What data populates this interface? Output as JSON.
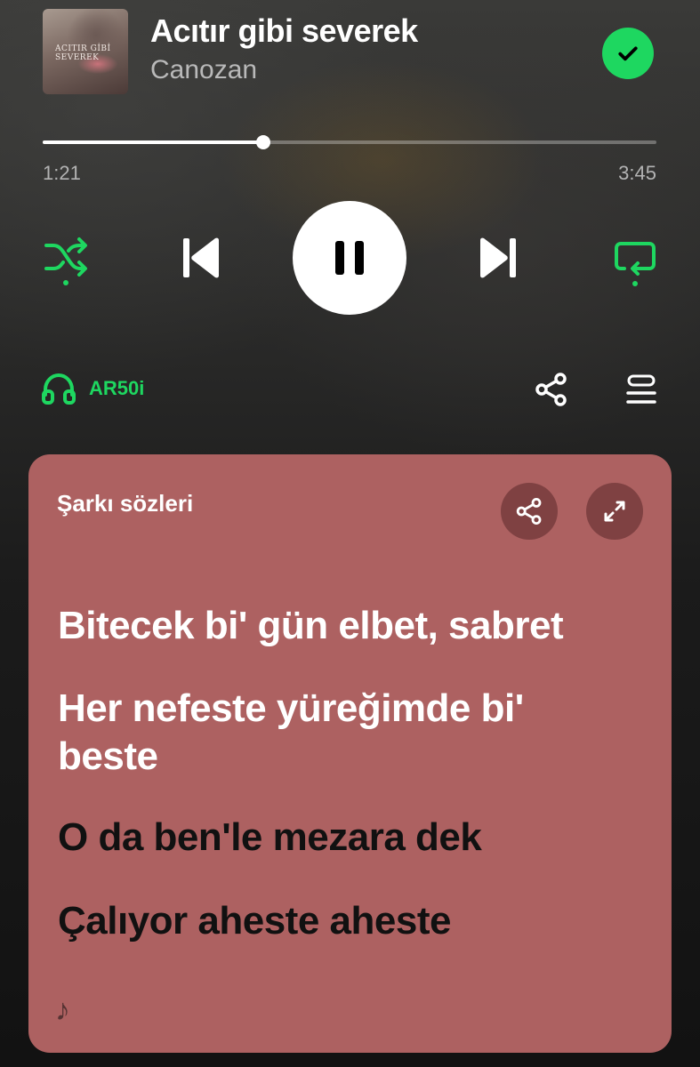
{
  "now_playing": {
    "album_art_text": "ACITIR GİBİ SEVEREK",
    "title": "Acıtır gibi severek",
    "artist": "Canozan",
    "liked": true
  },
  "playback": {
    "elapsed": "1:21",
    "duration": "3:45",
    "progress_fraction": 0.36,
    "is_playing": true,
    "shuffle_on": true,
    "repeat_on": true
  },
  "device": {
    "icon": "headphones-icon",
    "name": "AR50i"
  },
  "lyrics": {
    "title": "Şarkı sözleri",
    "lines": [
      {
        "text": "Bitecek bi' gün elbet, sabret",
        "state": "past"
      },
      {
        "text": "Her nefeste yüreğimde bi' beste",
        "state": "past"
      },
      {
        "text": "O da ben'le mezara dek",
        "state": "current"
      },
      {
        "text": "Çalıyor aheste aheste",
        "state": "current"
      }
    ],
    "note_symbol": "♪"
  },
  "colors": {
    "accent": "#1ed760",
    "lyrics_card": "#ad6161",
    "lyric_past": "#ffffff",
    "lyric_current": "#111111"
  }
}
